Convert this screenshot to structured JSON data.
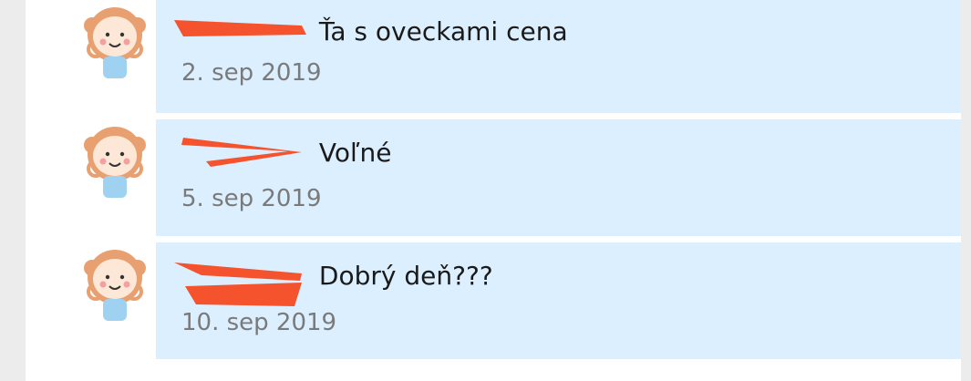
{
  "comments": [
    {
      "author_redacted": true,
      "message": "Ťa s oveckami cena",
      "date": "2. sep 2019"
    },
    {
      "author_redacted": true,
      "message": "Voľné",
      "date": "5. sep 2019"
    },
    {
      "author_redacted": true,
      "message": "Dobrý deň???",
      "date": "10. sep 2019"
    }
  ],
  "colors": {
    "bubble": "#dcefff",
    "redaction": "#f4532d",
    "author": "#2b78d4",
    "date": "#7a7a7a"
  },
  "icons": {
    "avatar": "girl-avatar-icon",
    "redaction": "redaction-scribble"
  }
}
